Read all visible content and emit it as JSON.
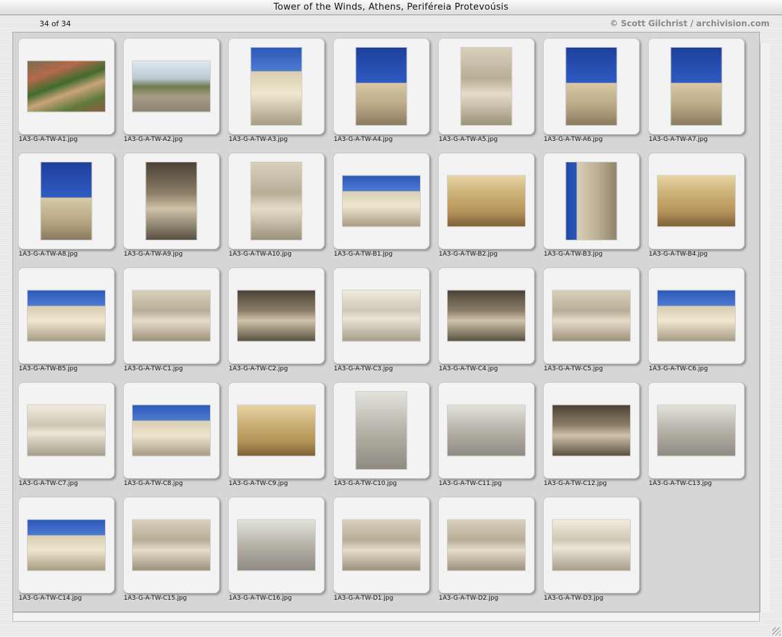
{
  "window": {
    "title": "Tower of the Winds, Athens, Periféreia Protevoúsis",
    "counter": "34 of 34",
    "credit": "© Scott Gilchrist / archivision.com"
  },
  "thumbnails": [
    {
      "file": "1A3-G-A-TW-A1.jpg",
      "orientation": "land",
      "tone": "t-town"
    },
    {
      "file": "1A3-G-A-TW-A2.jpg",
      "orientation": "land",
      "tone": "t-ruins"
    },
    {
      "file": "1A3-G-A-TW-A3.jpg",
      "orientation": "port",
      "tone": "t-sky2"
    },
    {
      "file": "1A3-G-A-TW-A4.jpg",
      "orientation": "port",
      "tone": "t-blue"
    },
    {
      "file": "1A3-G-A-TW-A5.jpg",
      "orientation": "port",
      "tone": "t-stone"
    },
    {
      "file": "1A3-G-A-TW-A6.jpg",
      "orientation": "port",
      "tone": "t-blue"
    },
    {
      "file": "1A3-G-A-TW-A7.jpg",
      "orientation": "port",
      "tone": "t-blue"
    },
    {
      "file": "1A3-G-A-TW-A8.jpg",
      "orientation": "port",
      "tone": "t-blue"
    },
    {
      "file": "1A3-G-A-TW-A9.jpg",
      "orientation": "port",
      "tone": "t-dark"
    },
    {
      "file": "1A3-G-A-TW-A10.jpg",
      "orientation": "port",
      "tone": "t-stone"
    },
    {
      "file": "1A3-G-A-TW-B1.jpg",
      "orientation": "land",
      "tone": "t-sky2"
    },
    {
      "file": "1A3-G-A-TW-B2.jpg",
      "orientation": "land",
      "tone": "t-warm"
    },
    {
      "file": "1A3-G-A-TW-B3.jpg",
      "orientation": "port",
      "tone": "t-tall"
    },
    {
      "file": "1A3-G-A-TW-B4.jpg",
      "orientation": "land",
      "tone": "t-warm"
    },
    {
      "file": "1A3-G-A-TW-B5.jpg",
      "orientation": "land",
      "tone": "t-sky2"
    },
    {
      "file": "1A3-G-A-TW-C1.jpg",
      "orientation": "land",
      "tone": "t-stone"
    },
    {
      "file": "1A3-G-A-TW-C2.jpg",
      "orientation": "land",
      "tone": "t-dark"
    },
    {
      "file": "1A3-G-A-TW-C3.jpg",
      "orientation": "land",
      "tone": "t-stone2"
    },
    {
      "file": "1A3-G-A-TW-C4.jpg",
      "orientation": "land",
      "tone": "t-dark"
    },
    {
      "file": "1A3-G-A-TW-C5.jpg",
      "orientation": "land",
      "tone": "t-stone"
    },
    {
      "file": "1A3-G-A-TW-C6.jpg",
      "orientation": "land",
      "tone": "t-sky2"
    },
    {
      "file": "1A3-G-A-TW-C7.jpg",
      "orientation": "land",
      "tone": "t-stone2"
    },
    {
      "file": "1A3-G-A-TW-C8.jpg",
      "orientation": "land",
      "tone": "t-sky2"
    },
    {
      "file": "1A3-G-A-TW-C9.jpg",
      "orientation": "land",
      "tone": "t-warm"
    },
    {
      "file": "1A3-G-A-TW-C10.jpg",
      "orientation": "port",
      "tone": "t-grey"
    },
    {
      "file": "1A3-G-A-TW-C11.jpg",
      "orientation": "land",
      "tone": "t-grey"
    },
    {
      "file": "1A3-G-A-TW-C12.jpg",
      "orientation": "land",
      "tone": "t-dark"
    },
    {
      "file": "1A3-G-A-TW-C13.jpg",
      "orientation": "land",
      "tone": "t-grey"
    },
    {
      "file": "1A3-G-A-TW-C14.jpg",
      "orientation": "land",
      "tone": "t-sky2"
    },
    {
      "file": "1A3-G-A-TW-C15.jpg",
      "orientation": "land",
      "tone": "t-stone"
    },
    {
      "file": "1A3-G-A-TW-C16.jpg",
      "orientation": "land",
      "tone": "t-grey"
    },
    {
      "file": "1A3-G-A-TW-D1.jpg",
      "orientation": "land",
      "tone": "t-stone"
    },
    {
      "file": "1A3-G-A-TW-D2.jpg",
      "orientation": "land",
      "tone": "t-stone"
    },
    {
      "file": "1A3-G-A-TW-D3.jpg",
      "orientation": "land",
      "tone": "t-stone2"
    }
  ]
}
